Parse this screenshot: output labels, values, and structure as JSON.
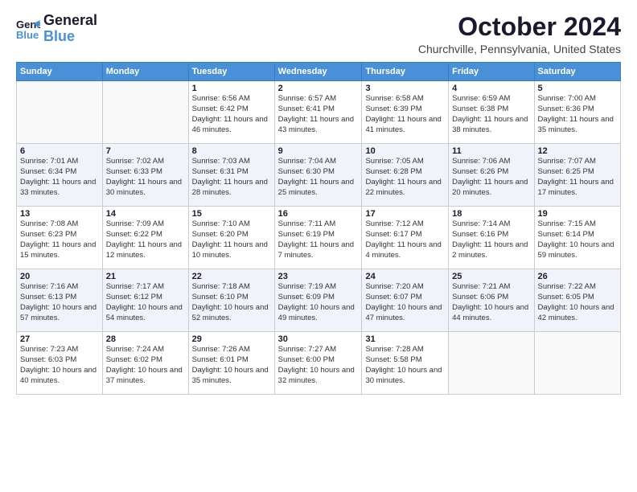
{
  "logo": {
    "line1": "General",
    "line2": "Blue"
  },
  "header": {
    "month": "October 2024",
    "location": "Churchville, Pennsylvania, United States"
  },
  "weekdays": [
    "Sunday",
    "Monday",
    "Tuesday",
    "Wednesday",
    "Thursday",
    "Friday",
    "Saturday"
  ],
  "weeks": [
    [
      {
        "day": null
      },
      {
        "day": null
      },
      {
        "day": "1",
        "sunrise": "6:56 AM",
        "sunset": "6:42 PM",
        "daylight": "11 hours and 46 minutes."
      },
      {
        "day": "2",
        "sunrise": "6:57 AM",
        "sunset": "6:41 PM",
        "daylight": "11 hours and 43 minutes."
      },
      {
        "day": "3",
        "sunrise": "6:58 AM",
        "sunset": "6:39 PM",
        "daylight": "11 hours and 41 minutes."
      },
      {
        "day": "4",
        "sunrise": "6:59 AM",
        "sunset": "6:38 PM",
        "daylight": "11 hours and 38 minutes."
      },
      {
        "day": "5",
        "sunrise": "7:00 AM",
        "sunset": "6:36 PM",
        "daylight": "11 hours and 35 minutes."
      }
    ],
    [
      {
        "day": "6",
        "sunrise": "7:01 AM",
        "sunset": "6:34 PM",
        "daylight": "11 hours and 33 minutes."
      },
      {
        "day": "7",
        "sunrise": "7:02 AM",
        "sunset": "6:33 PM",
        "daylight": "11 hours and 30 minutes."
      },
      {
        "day": "8",
        "sunrise": "7:03 AM",
        "sunset": "6:31 PM",
        "daylight": "11 hours and 28 minutes."
      },
      {
        "day": "9",
        "sunrise": "7:04 AM",
        "sunset": "6:30 PM",
        "daylight": "11 hours and 25 minutes."
      },
      {
        "day": "10",
        "sunrise": "7:05 AM",
        "sunset": "6:28 PM",
        "daylight": "11 hours and 22 minutes."
      },
      {
        "day": "11",
        "sunrise": "7:06 AM",
        "sunset": "6:26 PM",
        "daylight": "11 hours and 20 minutes."
      },
      {
        "day": "12",
        "sunrise": "7:07 AM",
        "sunset": "6:25 PM",
        "daylight": "11 hours and 17 minutes."
      }
    ],
    [
      {
        "day": "13",
        "sunrise": "7:08 AM",
        "sunset": "6:23 PM",
        "daylight": "11 hours and 15 minutes."
      },
      {
        "day": "14",
        "sunrise": "7:09 AM",
        "sunset": "6:22 PM",
        "daylight": "11 hours and 12 minutes."
      },
      {
        "day": "15",
        "sunrise": "7:10 AM",
        "sunset": "6:20 PM",
        "daylight": "11 hours and 10 minutes."
      },
      {
        "day": "16",
        "sunrise": "7:11 AM",
        "sunset": "6:19 PM",
        "daylight": "11 hours and 7 minutes."
      },
      {
        "day": "17",
        "sunrise": "7:12 AM",
        "sunset": "6:17 PM",
        "daylight": "11 hours and 4 minutes."
      },
      {
        "day": "18",
        "sunrise": "7:14 AM",
        "sunset": "6:16 PM",
        "daylight": "11 hours and 2 minutes."
      },
      {
        "day": "19",
        "sunrise": "7:15 AM",
        "sunset": "6:14 PM",
        "daylight": "10 hours and 59 minutes."
      }
    ],
    [
      {
        "day": "20",
        "sunrise": "7:16 AM",
        "sunset": "6:13 PM",
        "daylight": "10 hours and 57 minutes."
      },
      {
        "day": "21",
        "sunrise": "7:17 AM",
        "sunset": "6:12 PM",
        "daylight": "10 hours and 54 minutes."
      },
      {
        "day": "22",
        "sunrise": "7:18 AM",
        "sunset": "6:10 PM",
        "daylight": "10 hours and 52 minutes."
      },
      {
        "day": "23",
        "sunrise": "7:19 AM",
        "sunset": "6:09 PM",
        "daylight": "10 hours and 49 minutes."
      },
      {
        "day": "24",
        "sunrise": "7:20 AM",
        "sunset": "6:07 PM",
        "daylight": "10 hours and 47 minutes."
      },
      {
        "day": "25",
        "sunrise": "7:21 AM",
        "sunset": "6:06 PM",
        "daylight": "10 hours and 44 minutes."
      },
      {
        "day": "26",
        "sunrise": "7:22 AM",
        "sunset": "6:05 PM",
        "daylight": "10 hours and 42 minutes."
      }
    ],
    [
      {
        "day": "27",
        "sunrise": "7:23 AM",
        "sunset": "6:03 PM",
        "daylight": "10 hours and 40 minutes."
      },
      {
        "day": "28",
        "sunrise": "7:24 AM",
        "sunset": "6:02 PM",
        "daylight": "10 hours and 37 minutes."
      },
      {
        "day": "29",
        "sunrise": "7:26 AM",
        "sunset": "6:01 PM",
        "daylight": "10 hours and 35 minutes."
      },
      {
        "day": "30",
        "sunrise": "7:27 AM",
        "sunset": "6:00 PM",
        "daylight": "10 hours and 32 minutes."
      },
      {
        "day": "31",
        "sunrise": "7:28 AM",
        "sunset": "5:58 PM",
        "daylight": "10 hours and 30 minutes."
      },
      {
        "day": null
      },
      {
        "day": null
      }
    ]
  ]
}
